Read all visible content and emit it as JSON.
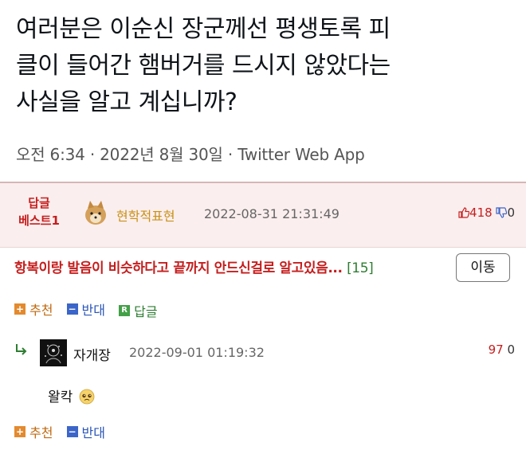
{
  "tweet": {
    "lines": [
      "여러분은 이순신 장군께선 평생토록 피",
      "클이 들어간 햄버거를 드시지 않았다는",
      "사실을 알고 계십니까?"
    ],
    "meta": "오전 6:34 · 2022년 8월 30일 · Twitter Web App"
  },
  "best": {
    "tag1": "답글",
    "tag2": "베스트1",
    "nick": "현학적표현",
    "date": "2022-08-31 21:31:49",
    "up": "418",
    "down": "0",
    "comment": "항복이랑 발음이 비슷하다고 끝까지 안드신걸로 알고있음...",
    "reply_count": "[15]",
    "move_label": "이동",
    "actions": {
      "recommend": "추천",
      "oppose": "반대",
      "reply": "답글"
    }
  },
  "reply": {
    "nick": "자개장",
    "date": "2022-09-01 01:19:32",
    "up": "97",
    "down": "0",
    "text": "왈칵",
    "actions": {
      "recommend": "추천",
      "oppose": "반대"
    }
  },
  "icons": [
    "reply-arrow-icon",
    "thumb-up-icon",
    "thumb-down-icon",
    "plus-icon",
    "minus-icon",
    "reply-icon",
    "pleading-face-icon"
  ],
  "colors": {
    "best_bg": "#fbeeee",
    "accent_red": "#c51e1e",
    "orange": "#e48a2e",
    "blue": "#3b65c9",
    "green": "#43a047"
  }
}
